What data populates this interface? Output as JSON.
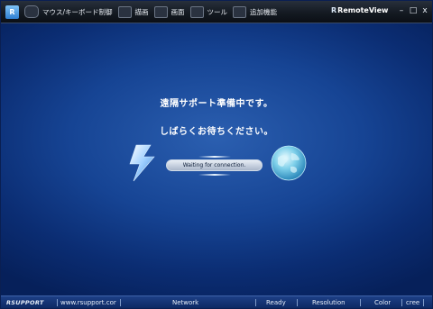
{
  "app": {
    "logo_text": "R",
    "brand": "RemoteView",
    "brand_mark": "R"
  },
  "toolbar": {
    "items": [
      {
        "label": "マウス/キーボード制御",
        "icon": "mouse-keyboard-icon"
      },
      {
        "label": "描画",
        "icon": "draw-icon"
      },
      {
        "label": "画面",
        "icon": "screen-icon"
      },
      {
        "label": "ツール",
        "icon": "tools-icon"
      },
      {
        "label": "追加機能",
        "icon": "extra-functions-icon"
      }
    ],
    "minimize": "–",
    "maximize": "□",
    "close": "x"
  },
  "main": {
    "message1": "遠隔サポート準備中です。",
    "message2": "しばらくお待ちください。",
    "status": "Waiting for connection.",
    "left_icon": "lightning-icon",
    "right_icon": "globe-icon"
  },
  "statusbar": {
    "logo": "RSUPPORT",
    "website": "www.rsupport.cor",
    "network": "Network",
    "ready": "Ready",
    "resolution": "Resolution",
    "color": "Color",
    "screen": "cree"
  },
  "colors": {
    "accent": "#164494",
    "titlebar": "#141a22",
    "statusbar": "#0c2861"
  }
}
